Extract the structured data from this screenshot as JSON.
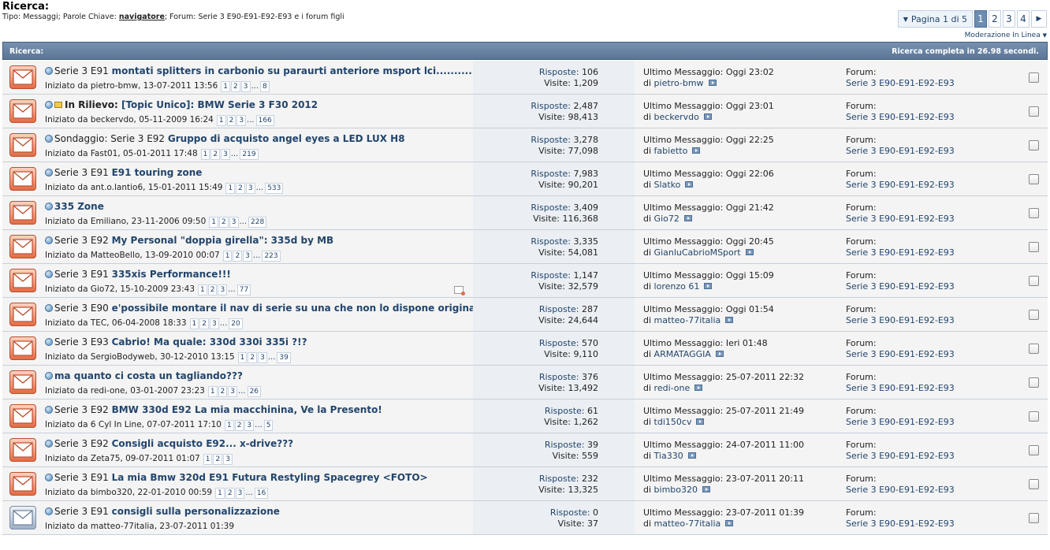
{
  "header": {
    "title": "Ricerca:",
    "crumb_prefix": "Tipo: Messaggi; Parole Chiave:",
    "crumb_keyword": "navigatore",
    "crumb_suffix": "; Forum: Serie 3 E90-E91-E92-E93 e i forum figli"
  },
  "pagination": {
    "info": "Pagina 1 di 5",
    "pages": [
      "1",
      "2",
      "3",
      "4"
    ],
    "current": "1"
  },
  "moderation_label": "Moderazione In Linea",
  "results_bar": {
    "left": "Ricerca:",
    "right": "Ricerca completa in 26.98 secondi."
  },
  "labels": {
    "replies": "Risposte:",
    "views": "Visite:",
    "last_message": "Ultimo Messaggio:",
    "by": "di",
    "forum": "Forum:",
    "started_by": "Iniziato da"
  },
  "threads": [
    {
      "prefix": "Serie 3 E91",
      "sticky": false,
      "title": "montati splitters in carbonio su paraurti anteriore msport lci............",
      "starter": "pietro-bmw",
      "started": "13-07-2011 13:56",
      "pages": [
        "1",
        "2",
        "3"
      ],
      "ellipsis": true,
      "last_page": "8",
      "replies": "106",
      "views": "1,209",
      "last_time": "Oggi 23:02",
      "last_user": "pietro-bmw",
      "forum": "Serie 3 E90-E91-E92-E93",
      "icon": "hot",
      "attachment": false
    },
    {
      "prefix": "In Rilievo:",
      "sticky": true,
      "title": "[Topic Unico]: BMW Serie 3 F30 2012",
      "starter": "beckervdo",
      "started": "05-11-2009 16:24",
      "pages": [
        "1",
        "2",
        "3"
      ],
      "ellipsis": true,
      "last_page": "166",
      "replies": "2,487",
      "views": "98,413",
      "last_time": "Oggi 23:01",
      "last_user": "beckervdo",
      "forum": "Serie 3 E90-E91-E92-E93",
      "icon": "hot",
      "attachment": false
    },
    {
      "prefix": "Sondaggio: Serie 3 E92",
      "sticky": false,
      "title": "Gruppo di acquisto angel eyes a LED LUX H8",
      "starter": "Fast01",
      "started": "05-01-2011 17:48",
      "pages": [
        "1",
        "2",
        "3"
      ],
      "ellipsis": true,
      "last_page": "219",
      "replies": "3,278",
      "views": "77,098",
      "last_time": "Oggi 22:25",
      "last_user": "fabietto",
      "forum": "Serie 3 E90-E91-E92-E93",
      "icon": "hot",
      "attachment": false
    },
    {
      "prefix": "Serie 3 E91",
      "sticky": false,
      "title": "E91 touring zone",
      "starter": "ant.o.lantio6",
      "started": "15-01-2011 15:49",
      "pages": [
        "1",
        "2",
        "3"
      ],
      "ellipsis": true,
      "last_page": "533",
      "replies": "7,983",
      "views": "90,201",
      "last_time": "Oggi 22:06",
      "last_user": "Slatko",
      "forum": "Serie 3 E90-E91-E92-E93",
      "icon": "hot",
      "attachment": false
    },
    {
      "prefix": "",
      "sticky": false,
      "title": "335 Zone",
      "starter": "Emiliano",
      "started": "23-11-2006 09:50",
      "pages": [
        "1",
        "2",
        "3"
      ],
      "ellipsis": true,
      "last_page": "228",
      "replies": "3,409",
      "views": "116,368",
      "last_time": "Oggi 21:42",
      "last_user": "Gio72",
      "forum": "Serie 3 E90-E91-E92-E93",
      "icon": "hot",
      "attachment": false
    },
    {
      "prefix": "Serie 3 E92",
      "sticky": false,
      "title": "My Personal \"doppia girella\": 335d by MB",
      "starter": "MatteoBello",
      "started": "13-09-2010 00:07",
      "pages": [
        "1",
        "2",
        "3"
      ],
      "ellipsis": true,
      "last_page": "223",
      "replies": "3,335",
      "views": "54,081",
      "last_time": "Oggi 20:45",
      "last_user": "GianluCabrioMSport",
      "forum": "Serie 3 E90-E91-E92-E93",
      "icon": "hot",
      "attachment": false
    },
    {
      "prefix": "Serie 3 E91",
      "sticky": false,
      "title": "335xis Performance!!!",
      "starter": "Gio72",
      "started": "15-10-2009 23:43",
      "pages": [
        "1",
        "2",
        "3"
      ],
      "ellipsis": true,
      "last_page": "77",
      "replies": "1,147",
      "views": "32,579",
      "last_time": "Oggi 15:09",
      "last_user": "lorenzo 61",
      "forum": "Serie 3 E90-E91-E92-E93",
      "icon": "hot",
      "attachment": true
    },
    {
      "prefix": "Serie 3 E90",
      "sticky": false,
      "title": "e'possibile montare il nav di serie su una che non lo dispone originalmente?",
      "starter": "TEC",
      "started": "06-04-2008 18:33",
      "pages": [
        "1",
        "2",
        "3"
      ],
      "ellipsis": true,
      "last_page": "20",
      "replies": "287",
      "views": "24,644",
      "last_time": "Oggi 01:54",
      "last_user": "matteo-77italia",
      "forum": "Serie 3 E90-E91-E92-E93",
      "icon": "hot",
      "attachment": false
    },
    {
      "prefix": "Serie 3 E93",
      "sticky": false,
      "title": "Cabrio! Ma quale: 330d 330i 335i ?!?",
      "starter": "SergioBodyweb",
      "started": "30-12-2010 13:15",
      "pages": [
        "1",
        "2",
        "3"
      ],
      "ellipsis": true,
      "last_page": "39",
      "replies": "570",
      "views": "9,110",
      "last_time": "Ieri 01:48",
      "last_user": "ARMATAGGIA",
      "forum": "Serie 3 E90-E91-E92-E93",
      "icon": "hot",
      "attachment": false
    },
    {
      "prefix": "",
      "sticky": false,
      "title": "ma quanto ci costa un tagliando???",
      "starter": "redi-one",
      "started": "03-01-2007 23:23",
      "pages": [
        "1",
        "2",
        "3"
      ],
      "ellipsis": true,
      "last_page": "26",
      "replies": "376",
      "views": "13,492",
      "last_time": "25-07-2011 22:32",
      "last_user": "redi-one",
      "forum": "Serie 3 E90-E91-E92-E93",
      "icon": "hot",
      "attachment": false
    },
    {
      "prefix": "Serie 3 E92",
      "sticky": false,
      "title": "BMW 330d E92 La mia macchinina, Ve la Presento!",
      "starter": "6 Cyl In Line",
      "started": "07-07-2011 17:10",
      "pages": [
        "1",
        "2",
        "3"
      ],
      "ellipsis": true,
      "last_page": "5",
      "replies": "61",
      "views": "1,262",
      "last_time": "25-07-2011 21:49",
      "last_user": "tdi150cv",
      "forum": "Serie 3 E90-E91-E92-E93",
      "icon": "hot",
      "attachment": false
    },
    {
      "prefix": "Serie 3 E92",
      "sticky": false,
      "title": "Consigli acquisto E92... x-drive???",
      "starter": "Zeta75",
      "started": "09-07-2011 01:07",
      "pages": [
        "1",
        "2",
        "3"
      ],
      "ellipsis": false,
      "last_page": "",
      "replies": "39",
      "views": "559",
      "last_time": "24-07-2011 11:00",
      "last_user": "Tia330",
      "forum": "Serie 3 E90-E91-E92-E93",
      "icon": "hot",
      "attachment": false
    },
    {
      "prefix": "Serie 3 E91",
      "sticky": false,
      "title": "La mia Bmw 320d E91 Futura Restyling Spacegrey <FOTO>",
      "starter": "bimbo320",
      "started": "22-01-2010 00:59",
      "pages": [
        "1",
        "2",
        "3"
      ],
      "ellipsis": true,
      "last_page": "16",
      "replies": "232",
      "views": "13,325",
      "last_time": "23-07-2011 20:11",
      "last_user": "bimbo320",
      "forum": "Serie 3 E90-E91-E92-E93",
      "icon": "hot",
      "attachment": false
    },
    {
      "prefix": "Serie 3 E91",
      "sticky": false,
      "title": "consigli sulla personalizzazione",
      "starter": "matteo-77italia",
      "started": "23-07-2011 01:39",
      "pages": [],
      "ellipsis": false,
      "last_page": "",
      "replies": "0",
      "views": "37",
      "last_time": "23-07-2011 01:39",
      "last_user": "matteo-77italia",
      "forum": "Serie 3 E90-E91-E92-E93",
      "icon": "normal",
      "attachment": false
    }
  ]
}
